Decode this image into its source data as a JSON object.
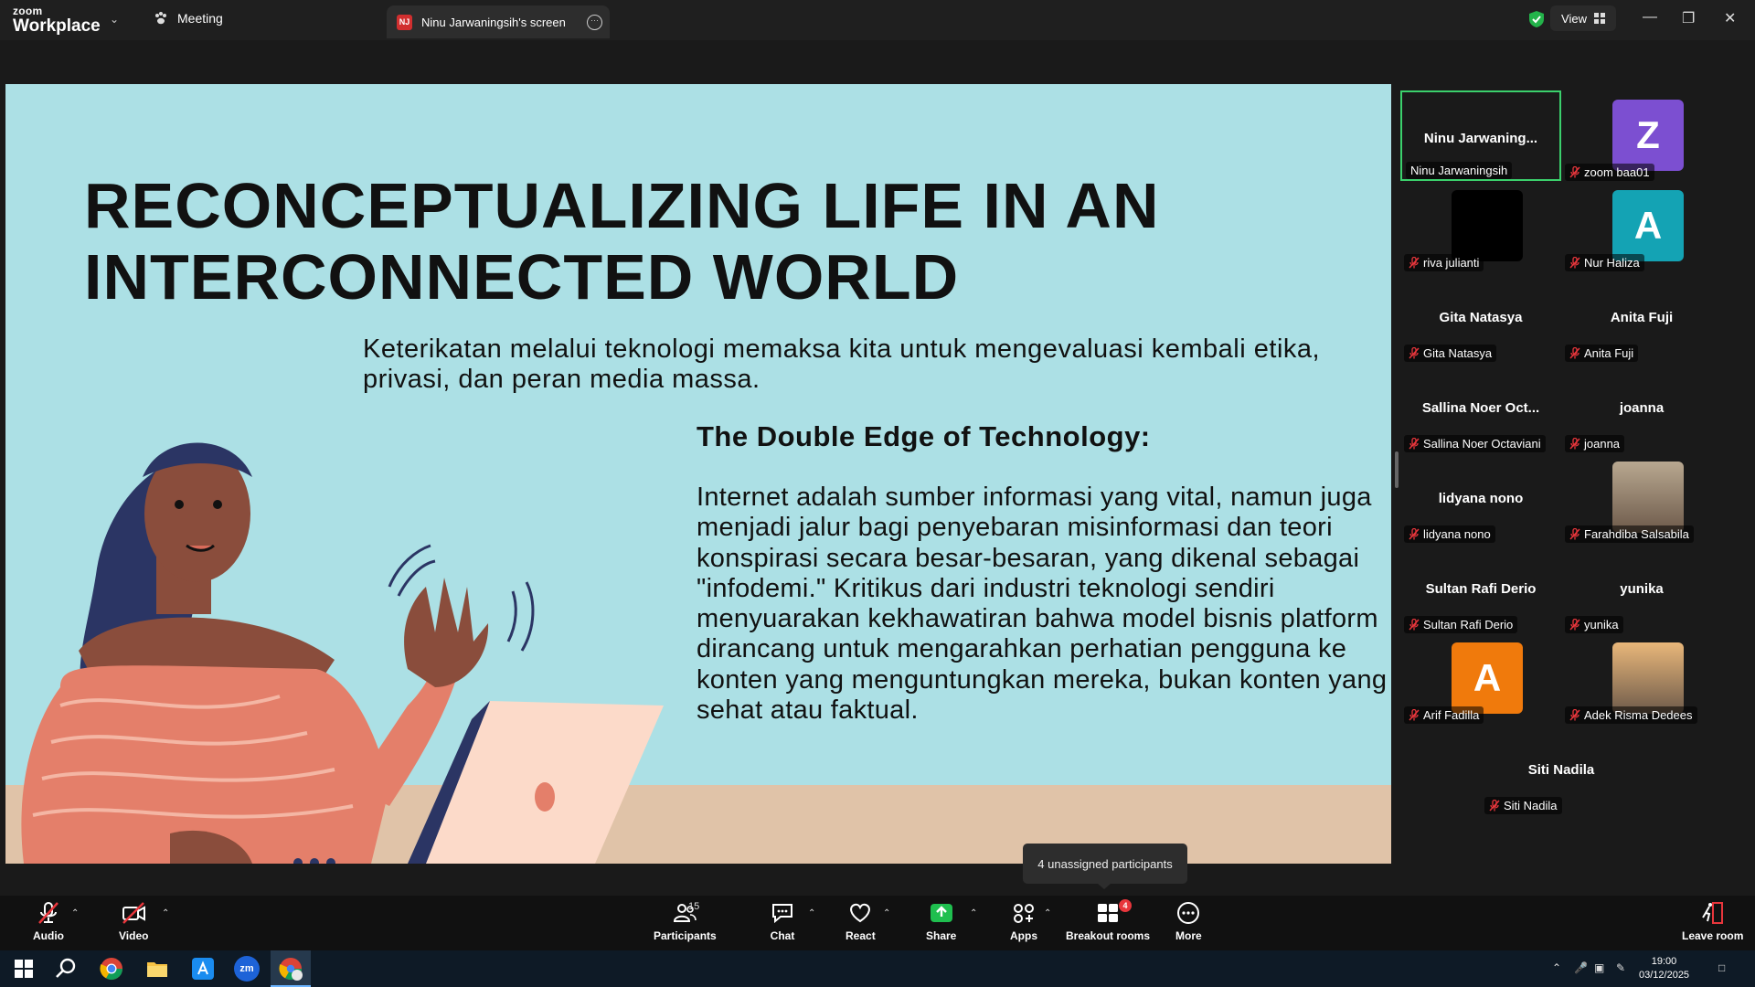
{
  "titlebar": {
    "brand_line1": "zoom",
    "brand_line2": "Workplace",
    "meeting_tab": "Meeting",
    "screen_tab_badge": "NJ",
    "screen_tab": "Ninu Jarwaningsih's screen",
    "view_label": "View"
  },
  "slide": {
    "title_line1": "RECONCEPTUALIZING LIFE IN AN",
    "title_line2": "INTERCONNECTED WORLD",
    "subtitle": "Keterikatan melalui teknologi memaksa kita untuk mengevaluasi kembali etika, privasi, dan peran media massa.",
    "heading": "The Double Edge of Technology:",
    "body": "Internet adalah sumber informasi yang vital, namun juga menjadi jalur bagi penyebaran misinformasi dan teori konspirasi secara besar-besaran, yang dikenal sebagai \"infodemi.\" Kritikus dari industri teknologi sendiri menyuarakan kekhawatiran bahwa model bisnis platform dirancang untuk mengarahkan perhatian pengguna ke konten yang menguntungkan mereka, bukan konten yang sehat atau faktual."
  },
  "participants": [
    {
      "tile_name": "Ninu  Jarwaning...",
      "label": "Ninu Jarwaningsih",
      "muted": false,
      "active": true
    },
    {
      "tile_name": "",
      "label": "zoom baa01",
      "muted": true,
      "avatar": "Z",
      "color": "#7c4fd1"
    },
    {
      "tile_name": "",
      "label": "riva julianti",
      "muted": true,
      "avatar": "",
      "color": "#000000"
    },
    {
      "tile_name": "",
      "label": "Nur Haliza",
      "muted": true,
      "avatar": "A",
      "color": "#14a3b4"
    },
    {
      "tile_name": "Gita Natasya",
      "label": "Gita Natasya",
      "muted": true
    },
    {
      "tile_name": "Anita Fuji",
      "label": "Anita Fuji",
      "muted": true
    },
    {
      "tile_name": "Sallina  Noer  Oct...",
      "label": "Sallina Noer Octaviani",
      "muted": true
    },
    {
      "tile_name": "joanna",
      "label": "joanna",
      "muted": true
    },
    {
      "tile_name": "lidyana nono",
      "label": "lidyana nono",
      "muted": true
    },
    {
      "tile_name": "",
      "label": "Farahdiba Salsabila",
      "muted": true,
      "photo": true,
      "color": "#b8a890"
    },
    {
      "tile_name": "Sultan Rafi Derio",
      "label": "Sultan Rafi Derio",
      "muted": true
    },
    {
      "tile_name": "yunika",
      "label": "yunika",
      "muted": true
    },
    {
      "tile_name": "",
      "label": "Arif Fadilla",
      "muted": true,
      "avatar": "A",
      "color": "#f07a0c"
    },
    {
      "tile_name": "",
      "label": "Adek Risma Dedees",
      "muted": true,
      "photo": true,
      "color": "#e9b77a"
    },
    {
      "tile_name": "Siti Nadila",
      "label": "Siti Nadila",
      "muted": true
    }
  ],
  "tooltip": "4 unassigned participants",
  "toolbar": {
    "audio": "Audio",
    "video": "Video",
    "participants": "Participants",
    "participants_count": "15",
    "chat": "Chat",
    "react": "React",
    "share": "Share",
    "apps": "Apps",
    "breakout": "Breakout rooms",
    "breakout_badge": "4",
    "more": "More",
    "leave": "Leave room"
  },
  "taskbar": {
    "time": "19:00",
    "date": "03/12/2025",
    "zm_label": "zm"
  },
  "colors": {
    "accent_green": "#3bd06c",
    "share_green": "#1fbf4f",
    "slide_bg": "#ace0e5",
    "muted_red": "#e8363c"
  }
}
